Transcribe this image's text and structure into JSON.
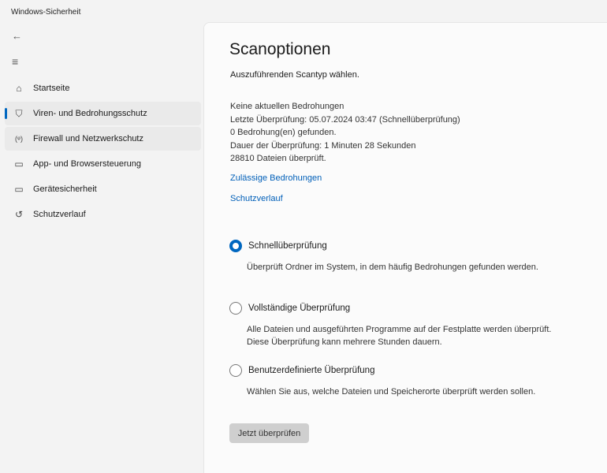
{
  "window_title": "Windows-Sicherheit",
  "nav": [
    {
      "label": "Startseite",
      "icon": "⌂"
    },
    {
      "label": "Viren- und Bedrohungsschutz",
      "icon": "⛉"
    },
    {
      "label": "Firewall und Netzwerkschutz",
      "icon": "(ᵠ)"
    },
    {
      "label": "App- und Browsersteuerung",
      "icon": "▭"
    },
    {
      "label": "Gerätesicherheit",
      "icon": "▭"
    },
    {
      "label": "Schutzverlauf",
      "icon": "↺"
    }
  ],
  "page": {
    "title": "Scanoptionen",
    "subtitle": "Auszuführenden Scantyp wählen.",
    "status": [
      "Keine aktuellen Bedrohungen",
      "Letzte Überprüfung: 05.07.2024 03:47 (Schnellüberprüfung)",
      "0 Bedrohung(en) gefunden.",
      "Dauer der Überprüfung: 1 Minuten 28 Sekunden",
      "28810 Dateien überprüft."
    ],
    "links": [
      "Zulässige Bedrohungen",
      "Schutzverlauf"
    ],
    "options": [
      {
        "label": "Schnellüberprüfung",
        "desc": "Überprüft Ordner im System, in dem häufig Bedrohungen gefunden werden.",
        "selected": true
      },
      {
        "label": "Vollständige Überprüfung",
        "desc": "Alle Dateien und ausgeführten Programme auf der Festplatte werden überprüft. Diese Überprüfung kann mehrere Stunden dauern.",
        "selected": false
      },
      {
        "label": "Benutzerdefinierte Überprüfung",
        "desc": "Wählen Sie aus, welche Dateien und Speicherorte überprüft werden sollen.",
        "selected": false
      }
    ],
    "scan_button": "Jetzt überprüfen"
  }
}
